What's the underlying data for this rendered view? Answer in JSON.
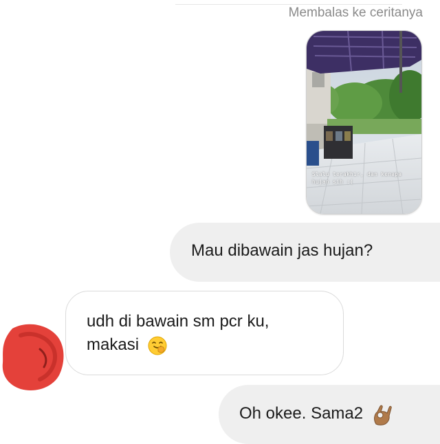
{
  "story_reply": {
    "header": "Membalas ke ceritanya",
    "caption": "Slalu terakhir, dan kenapa hujan sih :("
  },
  "messages": [
    {
      "direction": "outgoing",
      "text": "Mau dibawain jas hujan?"
    },
    {
      "direction": "incoming",
      "lines": [
        "udh di bawain sm pcr ku,",
        "makasi"
      ],
      "emoji": "shy-smiling-face-emoji"
    },
    {
      "direction": "outgoing",
      "text": "Oh okee. Sama2",
      "emoji": "ok-hand-emoji"
    }
  ],
  "colors": {
    "outgoing_bubble": "#efefef",
    "incoming_bubble_border": "#dadada",
    "header_text": "#8a8a8a",
    "avatar_scribble": "#e4413a"
  }
}
